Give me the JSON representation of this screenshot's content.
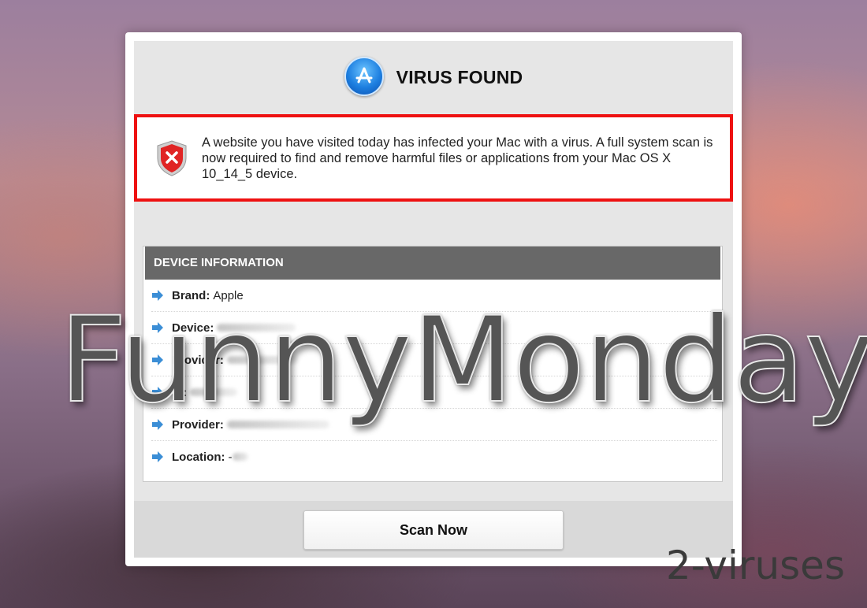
{
  "header": {
    "title": "VIRUS FOUND",
    "icon": "app-store-icon"
  },
  "alert": {
    "icon": "shield-error-icon",
    "message": "A website you have visited today has infected your Mac with a virus. A full system scan is now required to find and remove harmful files or applications from your Mac OS X 10_14_5 device."
  },
  "device_info": {
    "heading": "DEVICE INFORMATION",
    "rows": [
      {
        "label": "Brand:",
        "value": "Apple",
        "redacted": false
      },
      {
        "label": "Device:",
        "value": "",
        "redacted": true
      },
      {
        "label": "Provider:",
        "value": "",
        "redacted": true
      },
      {
        "label": "IP:",
        "value": "",
        "redacted": true
      },
      {
        "label": "Provider:",
        "value": "",
        "redacted": true
      },
      {
        "label": "Location:",
        "value": "-",
        "redacted": true
      }
    ]
  },
  "footer": {
    "scan_label": "Scan Now"
  },
  "overlay": {
    "watermark": "FunnyMonday",
    "brand": "2-viruses"
  },
  "colors": {
    "alert_border": "#ee1111",
    "heading_bg": "#686868",
    "arrow": "#3b8ed6"
  }
}
